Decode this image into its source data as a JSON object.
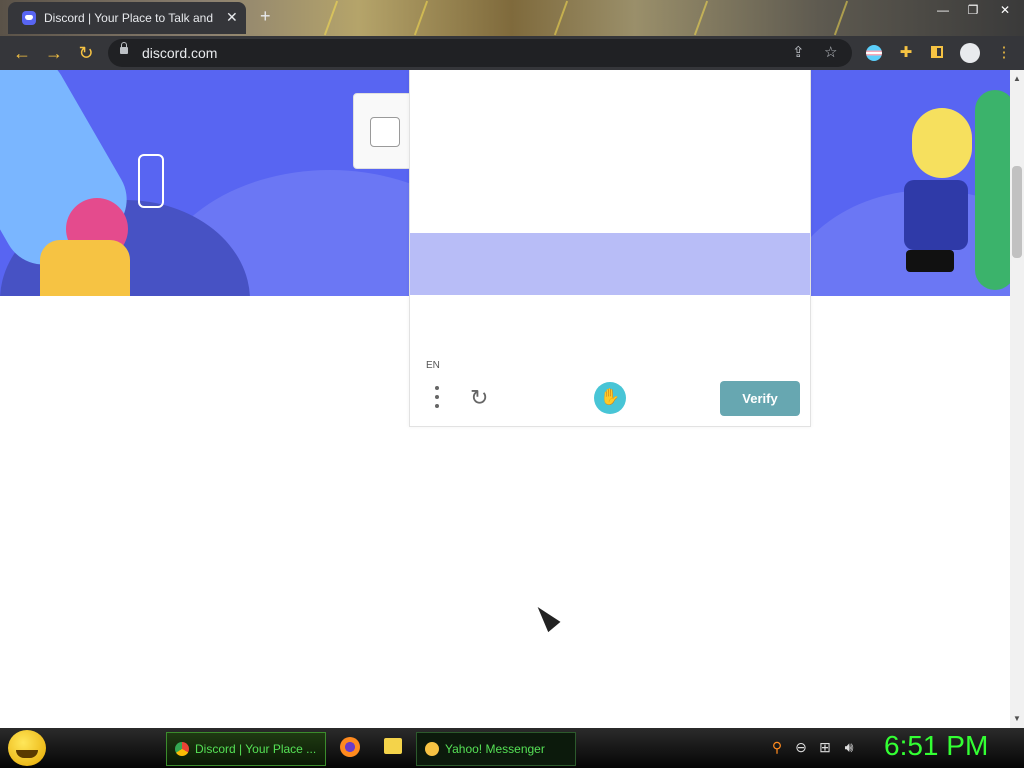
{
  "browser": {
    "tab_title": "Discord | Your Place to Talk and Hang Out",
    "tab_close": "✕",
    "new_tab": "+",
    "url": "discord.com"
  },
  "captcha": {
    "language": "EN",
    "verify_label": "Verify"
  },
  "taskbar": {
    "tasks": [
      {
        "label": "Discord | Your Place ..."
      },
      {
        "label": "Yahoo! Messenger"
      }
    ],
    "clock": "6:51 PM"
  },
  "colors": {
    "banner": "#5865f2",
    "verify_button": "#67a7b1",
    "clock": "#33ff33"
  },
  "icons": [
    "back-icon",
    "forward-icon",
    "reload-icon",
    "lock-icon",
    "share-icon",
    "bookmark-star-icon",
    "profile-icon",
    "extensions-icon",
    "sidepanel-icon",
    "account-icon",
    "menu-icon"
  ]
}
